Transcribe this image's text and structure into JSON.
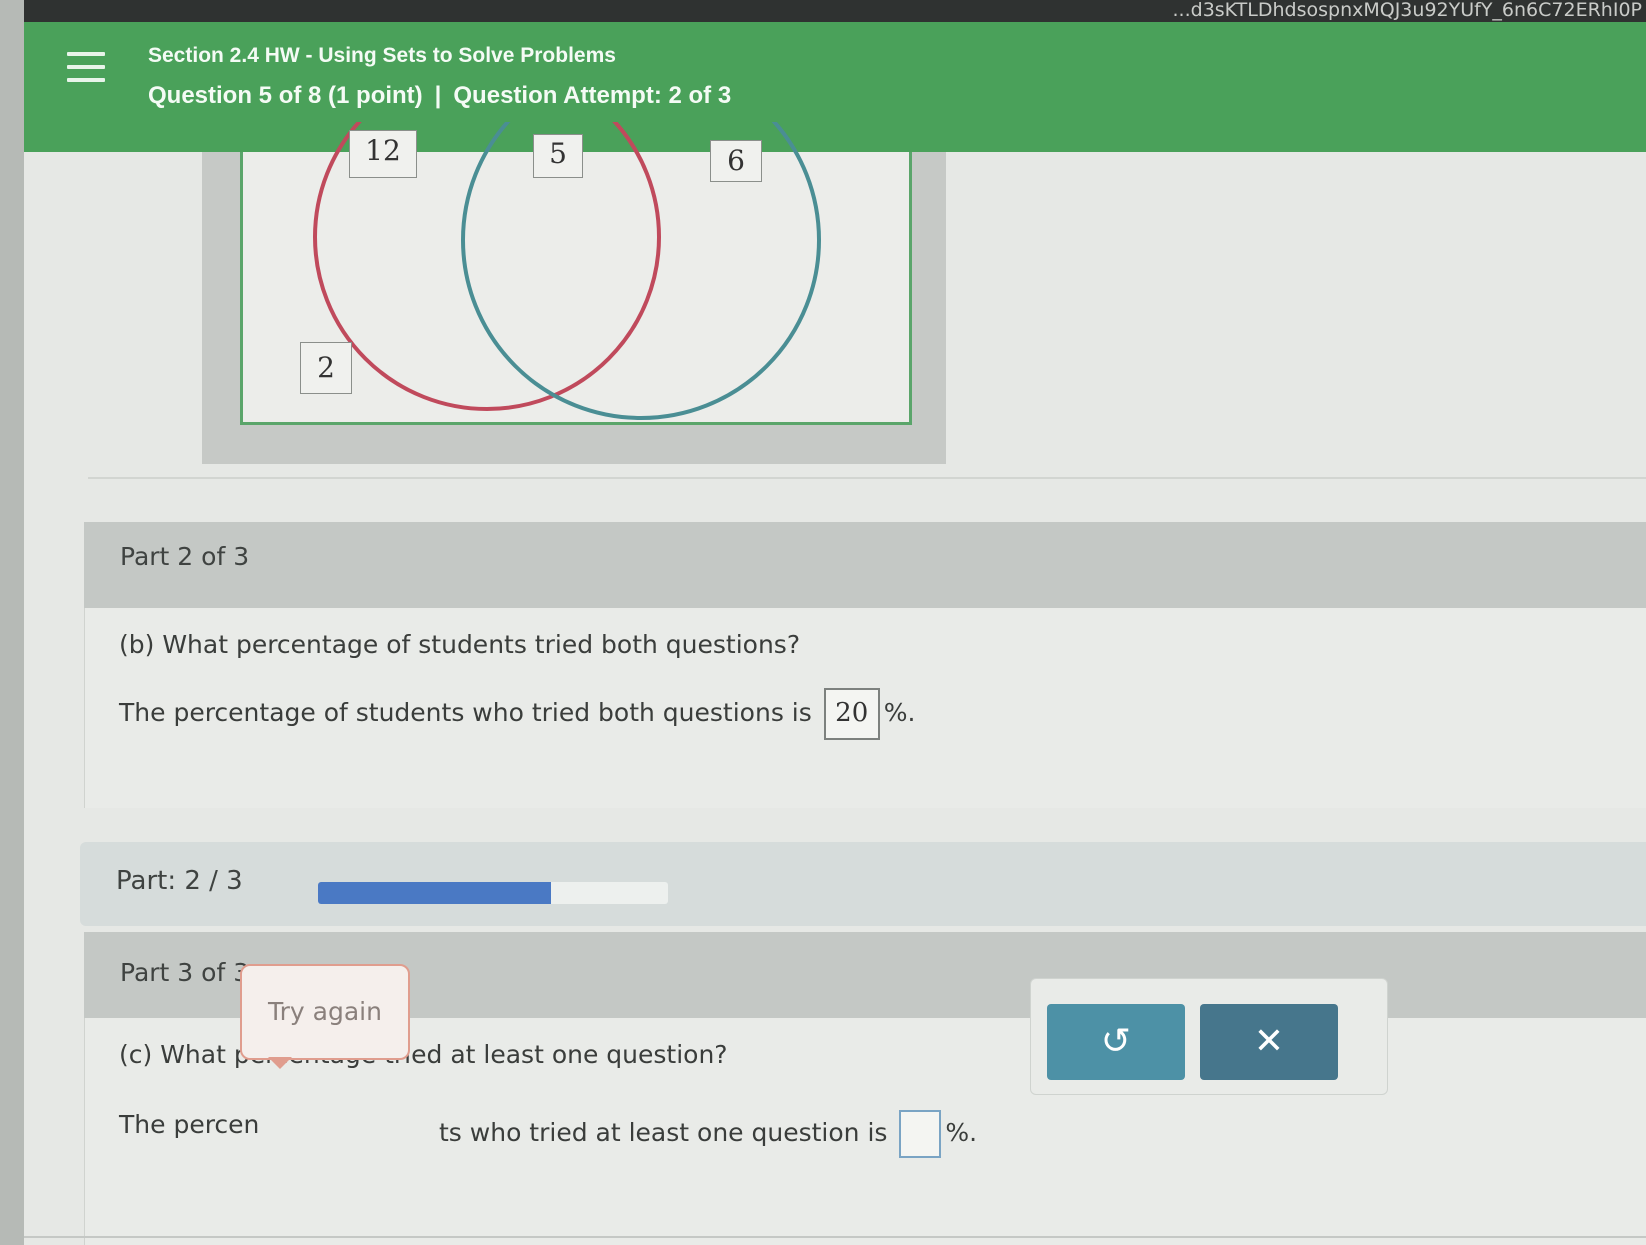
{
  "top_strip": {
    "url_fragment": "...d3sKTLDhdsospnxMQJ3u92YUfY_6n6C72ERhI0P"
  },
  "header": {
    "section_title": "Section 2.4 HW - Using Sets to Solve Problems",
    "question_info": "Question 5 of 8 (1 point)",
    "separator": "|",
    "attempt_info": "Question Attempt: 2 of 3",
    "menu_icon": "hamburger-menu-icon"
  },
  "venn": {
    "left_only": "12",
    "both": "5",
    "right_only": "6",
    "neither": "2",
    "left_circle_color": "#c04a5c",
    "right_circle_color": "#4a8e94"
  },
  "part2": {
    "header": "Part 2 of 3",
    "question": "(b) What percentage of students tried both questions?",
    "answer_prefix": "The percentage of students who tried both questions is",
    "answer_value": "20",
    "answer_suffix": "%."
  },
  "progress": {
    "label": "Part: 2 / 3",
    "fraction": 0.667,
    "fill_color": "#4a79c4"
  },
  "part3": {
    "header": "Part 3 of 3",
    "question": "(c) What percentage tried at least one question?",
    "answer_prefix_visible": "The percen",
    "answer_middle_visible": "ts who tried at least one question is",
    "answer_value": "",
    "answer_suffix": "%."
  },
  "tooltip": {
    "text": "Try again"
  },
  "buttons": {
    "redo_icon": "undo-icon",
    "redo_glyph": "↺",
    "clear_icon": "close-icon",
    "clear_glyph": "✕"
  }
}
